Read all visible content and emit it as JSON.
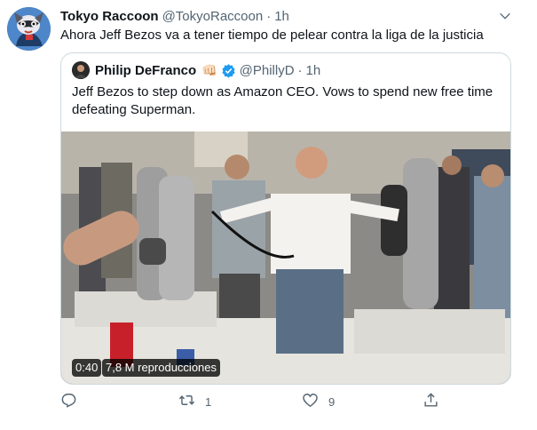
{
  "tweet": {
    "display_name": "Tokyo Raccoon",
    "handle": "@TokyoRaccoon",
    "separator": "·",
    "time": "1h",
    "text": "Ahora Jeff Bezos va a tener tiempo de pelear contra la liga de la justicia",
    "avatar_icon": "raccoon-avatar-icon",
    "more_icon": "chevron-down-icon"
  },
  "quoted": {
    "display_name": "Philip DeFranco",
    "emoji": "👊🏻",
    "verified_icon": "verified-badge-icon",
    "handle": "@PhillyD",
    "separator": "·",
    "time": "1h",
    "text": "Jeff Bezos to step down as Amazon CEO. Vows to spend new free time defeating Superman.",
    "video": {
      "duration": "0:40",
      "views": "7,8 M reproducciones"
    }
  },
  "actions": {
    "reply_count": "",
    "retweet_count": "1",
    "like_count": "9",
    "reply_icon": "reply-icon",
    "retweet_icon": "retweet-icon",
    "like_icon": "heart-icon",
    "share_icon": "share-icon"
  },
  "colors": {
    "text_primary": "#0f1419",
    "text_secondary": "#536471",
    "border": "#cfd9de",
    "verified": "#1d9bf0"
  }
}
